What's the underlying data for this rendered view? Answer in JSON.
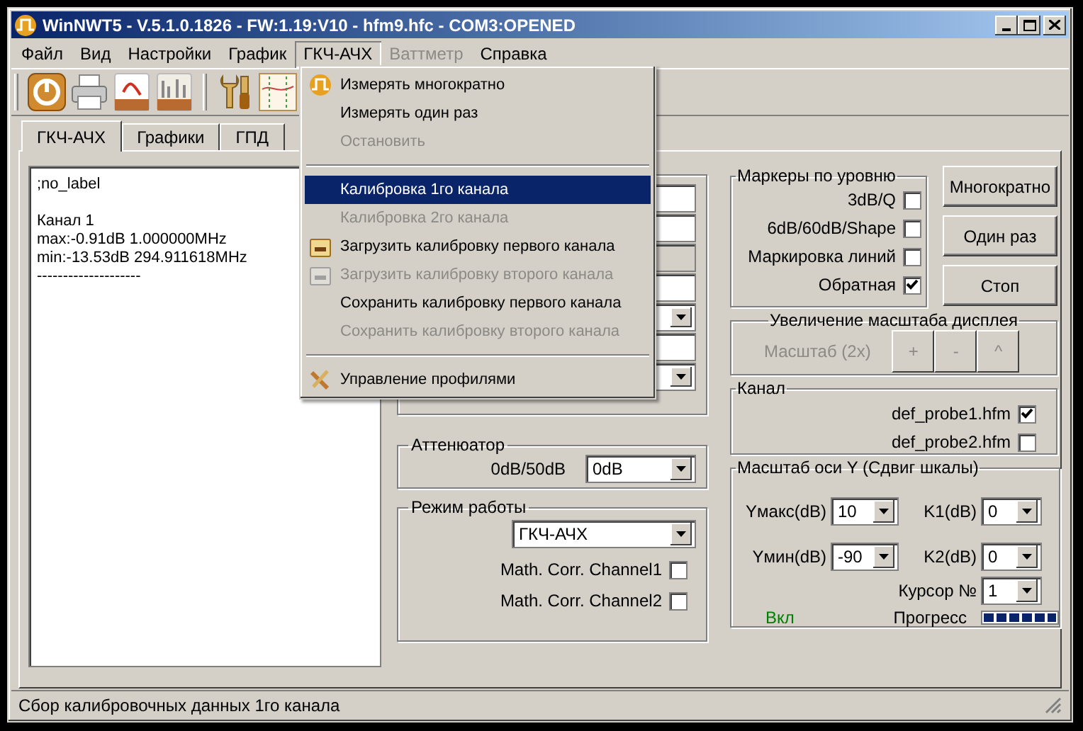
{
  "window": {
    "title": "WinNWT5 - V.5.1.0.1826 - FW:1.19:V10 - hfm9.hfc - COM3:OPENED"
  },
  "menu_bar": [
    {
      "label": "Файл",
      "open": false,
      "disabled": false
    },
    {
      "label": "Вид",
      "open": false,
      "disabled": false
    },
    {
      "label": "Настройки",
      "open": false,
      "disabled": false
    },
    {
      "label": "График",
      "open": false,
      "disabled": false
    },
    {
      "label": "ГКЧ-АЧХ",
      "open": true,
      "disabled": false
    },
    {
      "label": "Ваттметр",
      "open": false,
      "disabled": true
    },
    {
      "label": "Справка",
      "open": false,
      "disabled": false
    }
  ],
  "open_menu": {
    "items": [
      {
        "kind": "measure",
        "label": "Измерять многократно",
        "disabled": false,
        "selected": false
      },
      {
        "kind": "plain",
        "label": "Измерять один раз",
        "disabled": false,
        "selected": false
      },
      {
        "kind": "plain",
        "label": "Остановить",
        "disabled": true,
        "selected": false
      },
      {
        "kind": "separator"
      },
      {
        "kind": "plain",
        "label": "Калибровка 1го канала",
        "disabled": false,
        "selected": true
      },
      {
        "kind": "plain",
        "label": "Калибровка 2го канала",
        "disabled": true,
        "selected": false
      },
      {
        "kind": "ch1",
        "label": "Загрузить калибровку первого  канала",
        "disabled": false,
        "selected": false
      },
      {
        "kind": "ch2",
        "label": "Загрузить калибровку второго  канала",
        "disabled": true,
        "selected": false
      },
      {
        "kind": "plain",
        "label": "Сохранить калибровку первого канала",
        "disabled": false,
        "selected": false
      },
      {
        "kind": "plain",
        "label": "Сохранить калибровку второго канала",
        "disabled": true,
        "selected": false
      },
      {
        "kind": "separator"
      },
      {
        "kind": "profiles",
        "label": "Управление профилями",
        "disabled": false,
        "selected": false
      }
    ]
  },
  "tabs": [
    {
      "label": "ГКЧ-АЧХ",
      "selected": true
    },
    {
      "label": "Графики",
      "selected": false
    },
    {
      "label": "ГПД",
      "selected": false
    }
  ],
  "output": [
    {
      "lines": [
        ";no_label"
      ]
    },
    {
      "lines": [
        "Канал 1",
        "max:-0.91dB 1.000000MHz",
        "min:-13.53dB 294.911618MHz",
        "--------------------"
      ]
    }
  ],
  "attenuator": {
    "title": "Аттенюатор",
    "label": "0dB/50dB",
    "value": "0dB"
  },
  "mode": {
    "title": "Режим работы",
    "value": "ГКЧ-АЧХ",
    "checks": [
      {
        "label": "Math. Corr. Channel1",
        "checked": false
      },
      {
        "label": "Math. Corr. Channel2",
        "checked": false
      }
    ]
  },
  "markers": {
    "title": "Маркеры по уровню",
    "checks": [
      {
        "label": "3dB/Q",
        "checked": false
      },
      {
        "label": "6dB/60dB/Shape",
        "checked": false
      },
      {
        "label": "Маркировка линий",
        "checked": false
      },
      {
        "label": "Обратная",
        "checked": true
      }
    ]
  },
  "buttons": [
    "Многократно",
    "Один раз",
    "Стоп"
  ],
  "zoom": {
    "title": "Увеличение масштаба дисплея",
    "label": "Масштаб (2x)",
    "disabled": true,
    "buttons": [
      "+",
      "-",
      "^"
    ]
  },
  "channel": {
    "title": "Канал",
    "checks": [
      {
        "label": "def_probe1.hfm",
        "checked": true
      },
      {
        "label": "def_probe2.hfm",
        "checked": false
      }
    ]
  },
  "y_scale": {
    "title": "Масштаб оси Y (Сдвиг шкалы)",
    "ymax": {
      "label": "Yмакс(dB)",
      "value": "10"
    },
    "k1": {
      "label": "K1(dB)",
      "value": "0"
    },
    "ymin": {
      "label": "Yмин(dB)",
      "value": "-90"
    },
    "k2": {
      "label": "K2(dB)",
      "value": "0"
    },
    "cursor": {
      "label": "Курсор №",
      "value": "1"
    },
    "state": "Вкл",
    "progress_label": "Прогресс",
    "progress": {
      "level": 1
    }
  },
  "status_bar": "Сбор калибровочных данных 1го канала"
}
